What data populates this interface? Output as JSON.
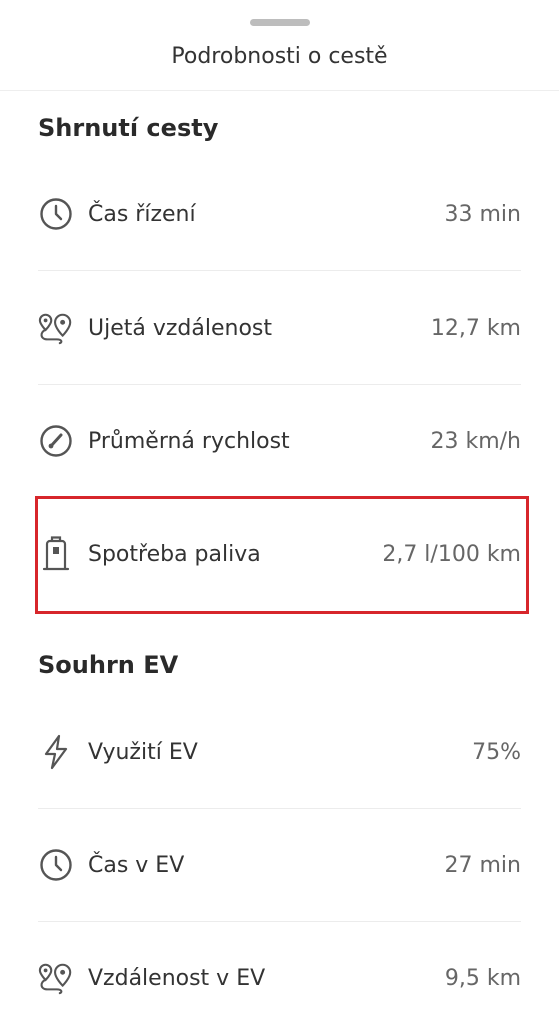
{
  "sheet": {
    "title": "Podrobnosti o cestě"
  },
  "trip_summary": {
    "title": "Shrnutí cesty",
    "rows": [
      {
        "icon": "clock-icon",
        "label": "Čas řízení",
        "value": "33 min"
      },
      {
        "icon": "route-pin-icon",
        "label": "Ujetá vzdálenost",
        "value": "12,7 km"
      },
      {
        "icon": "speedometer-icon",
        "label": "Průměrná rychlost",
        "value": "23 km/h"
      },
      {
        "icon": "fuel-pump-icon",
        "label": "Spotřeba paliva",
        "value": "2,7 l/100 km"
      }
    ]
  },
  "ev_summary": {
    "title": "Souhrn EV",
    "rows": [
      {
        "icon": "lightning-icon",
        "label": "Využití EV",
        "value": "75%"
      },
      {
        "icon": "clock-icon",
        "label": "Čas v EV",
        "value": "27 min"
      },
      {
        "icon": "route-pin-icon",
        "label": "Vzdálenost v EV",
        "value": "9,5 km"
      }
    ]
  },
  "colors": {
    "highlight": "#d7262b",
    "icon": "#555555",
    "text": "#333333",
    "value": "#666666"
  }
}
